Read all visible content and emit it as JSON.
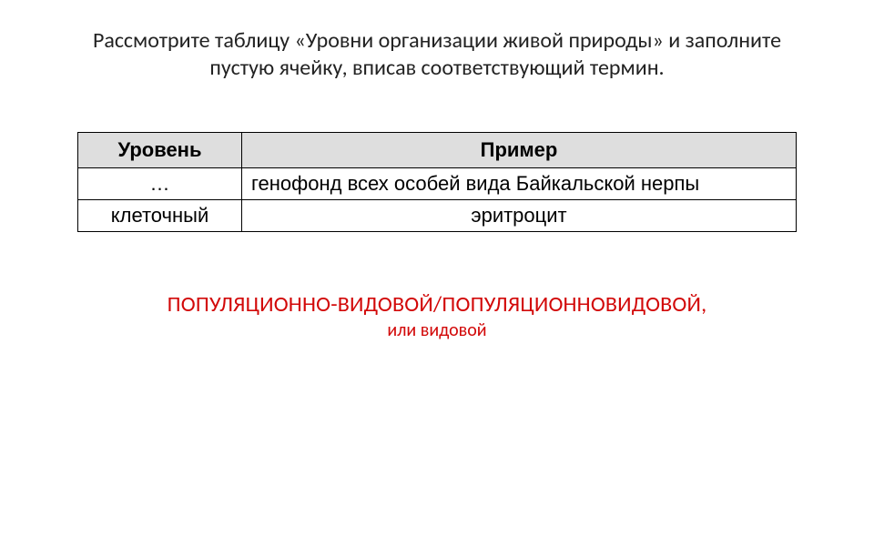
{
  "prompt": {
    "line1": "Рассмотрите таблицу «Уровни организации живой природы» и заполните",
    "line2": "пустую ячейку, вписав соответствующий термин."
  },
  "table": {
    "headers": {
      "level": "Уровень",
      "example": "Пример"
    },
    "rows": [
      {
        "level": "…",
        "example": "генофонд всех особей вида Байкальской нерпы"
      },
      {
        "level": "клеточный",
        "example": "эритроцит"
      }
    ]
  },
  "answer": {
    "main": "ПОПУЛЯЦИОННО-ВИДОВОЙ/ПОПУЛЯЦИОННОВИДОВОЙ,",
    "sub": "или видовой"
  }
}
